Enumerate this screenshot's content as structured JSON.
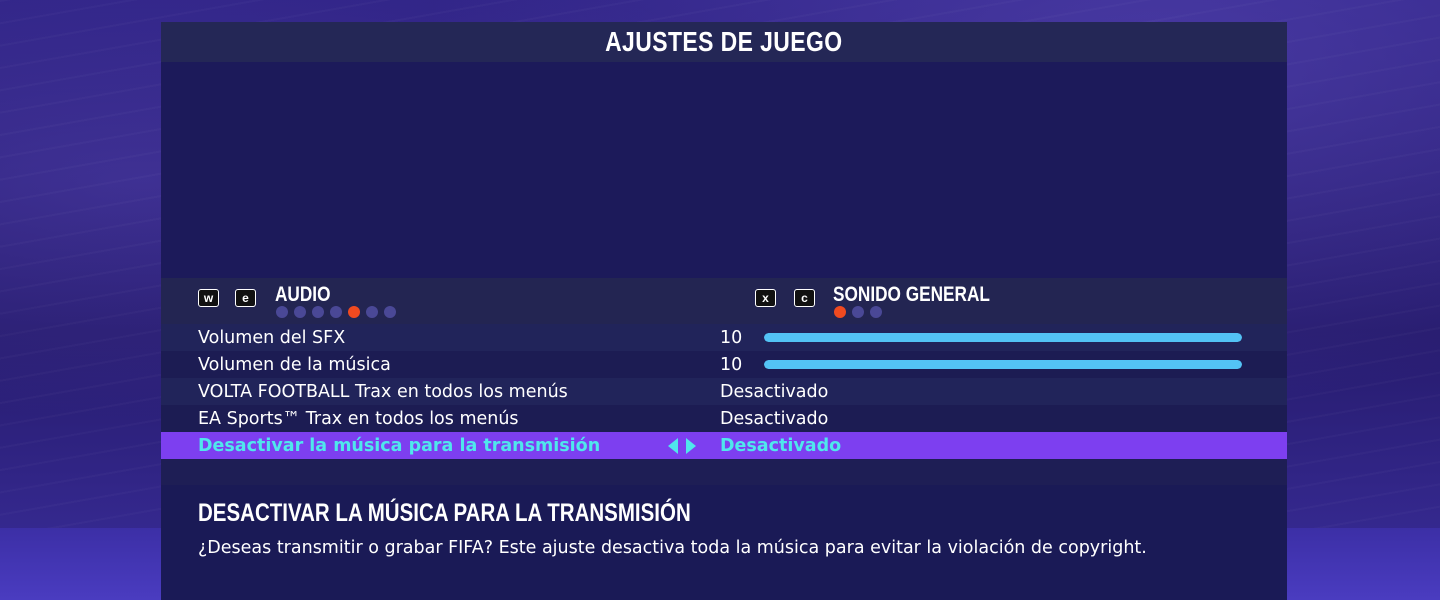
{
  "screen": {
    "title": "AJUSTES DE JUEGO"
  },
  "tabs": {
    "left": {
      "key1": "w",
      "key2": "e",
      "label": "AUDIO",
      "page_count": 7,
      "active_index": 4
    },
    "right": {
      "key1": "x",
      "key2": "c",
      "label": "SONIDO GENERAL",
      "page_count": 3,
      "active_index": 0
    }
  },
  "settings": [
    {
      "label": "Volumen del SFX",
      "value": "10",
      "type": "slider",
      "level": 1.0
    },
    {
      "label": "Volumen de la música",
      "value": "10",
      "type": "slider",
      "level": 1.0
    },
    {
      "label": "VOLTA FOOTBALL Trax en todos los menús",
      "value": "Desactivado",
      "type": "option"
    },
    {
      "label": "EA Sports™ Trax en todos los menús",
      "value": "Desactivado",
      "type": "option"
    },
    {
      "label": "Desactivar la música para la transmisión",
      "value": "Desactivado",
      "type": "option",
      "selected": true
    }
  ],
  "description": {
    "title": "DESACTIVAR LA MÚSICA PARA LA TRANSMISIÓN",
    "text": "¿Deseas transmitir o grabar FIFA? Este ajuste desactiva toda la música para evitar la violación de copyright."
  },
  "colors": {
    "selected_row": "#7d3ff0",
    "selected_text": "#4fe7ec",
    "slider_fill": "#53c3f5",
    "active_dot": "#f04a20",
    "inactive_dot": "#4a4896"
  }
}
